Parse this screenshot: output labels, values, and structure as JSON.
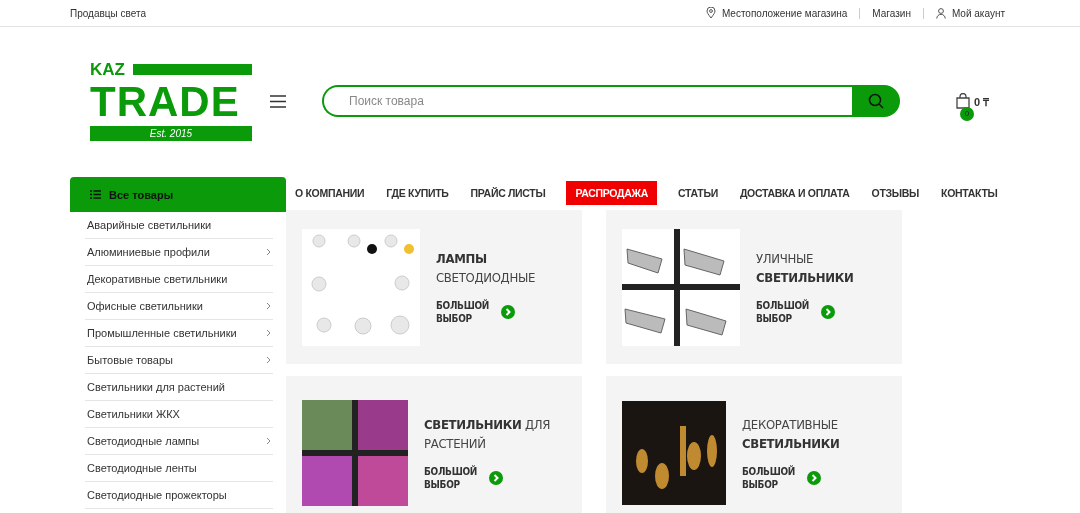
{
  "top_bar": {
    "tagline": "Продавцы света",
    "links": [
      {
        "kind": "location",
        "label": "Местоположение магазина"
      },
      {
        "kind": "plain",
        "label": "Магазин"
      },
      {
        "kind": "account",
        "label": "Мой акаунт"
      }
    ]
  },
  "header": {
    "logo": {
      "top": "KAZ",
      "main": "TRADE",
      "est": "Est. 2015"
    },
    "search": {
      "placeholder": "Поиск товара"
    },
    "cart": {
      "total": "0 ₸",
      "count": "0"
    }
  },
  "sidebar": {
    "title": "Все товары",
    "items": [
      {
        "label": "Аварийные светильники",
        "has_submenu": false
      },
      {
        "label": "Алюминиевые профили",
        "has_submenu": true
      },
      {
        "label": "Декоративные светильники",
        "has_submenu": false
      },
      {
        "label": "Офисные светильники",
        "has_submenu": true
      },
      {
        "label": "Промышленные светильники",
        "has_submenu": true
      },
      {
        "label": "Бытовые товары",
        "has_submenu": true
      },
      {
        "label": "Светильники для растений",
        "has_submenu": false
      },
      {
        "label": "Светильники ЖКХ",
        "has_submenu": false
      },
      {
        "label": "Светодиодные лампы",
        "has_submenu": true
      },
      {
        "label": "Светодиодные ленты",
        "has_submenu": false
      },
      {
        "label": "Светодиодные прожекторы",
        "has_submenu": false
      }
    ]
  },
  "nav": [
    {
      "label": "О КОМПАНИИ",
      "highlighted": false
    },
    {
      "label": "ГДЕ КУПИТЬ",
      "highlighted": false
    },
    {
      "label": "ПРАЙС ЛИСТЫ",
      "highlighted": false
    },
    {
      "label": "РАСПРОДАЖА",
      "highlighted": true
    },
    {
      "label": "СТАТЬИ",
      "highlighted": false
    },
    {
      "label": "ДОСТАВКА И ОПЛАТА",
      "highlighted": false
    },
    {
      "label": "ОТЗЫВЫ",
      "highlighted": false
    },
    {
      "label": "КОНТАКТЫ",
      "highlighted": false
    }
  ],
  "categories": [
    {
      "kind": "bulbs",
      "title": "**ЛАМПЫ**\nСВЕТОДИОДНЫЕ",
      "link": "БОЛЬШОЙ\nВЫБОР"
    },
    {
      "kind": "street",
      "title": "УЛИЧНЫЕ\n**СВЕТИЛЬНИКИ**",
      "link": "БОЛЬШОЙ\nВЫБОР"
    },
    {
      "kind": "plants",
      "title": "**СВЕТИЛЬНИКИ** ДЛЯ\nРАСТЕНИЙ",
      "link": "БОЛЬШОЙ\nВЫБОР"
    },
    {
      "kind": "decor",
      "title": "ДЕКОРАТИВНЫЕ\n**СВЕТИЛЬНИКИ**",
      "link": "БОЛЬШОЙ\nВЫБОР"
    }
  ]
}
